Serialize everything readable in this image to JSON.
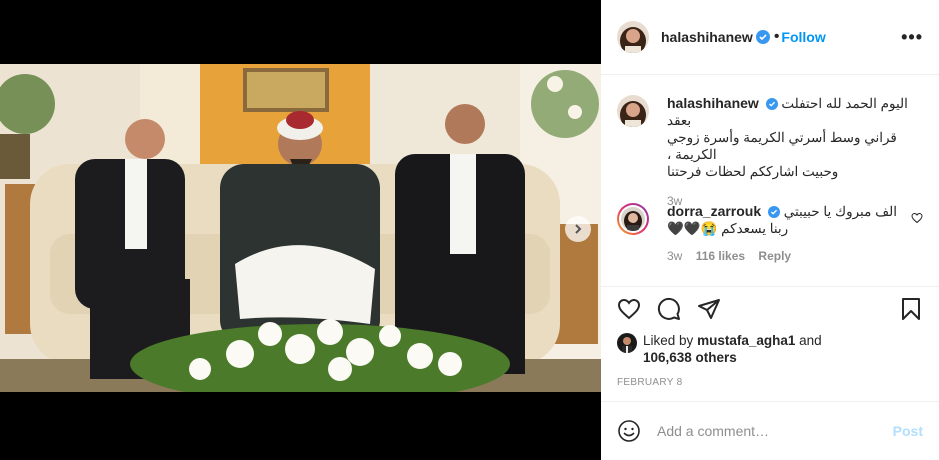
{
  "post": {
    "username": "halashihanew",
    "follow_label": "Follow",
    "more_label": "•••",
    "caption_line1": "اليوم الحمد لله احتفلت بعقد",
    "caption_line2": "قراني وسط أسرتي الكريمة وأسرة زوجي الكريمة ،",
    "caption_line3": "وحبيت اشارككم لحظات فرحتنا",
    "caption_time": "3w"
  },
  "comment": {
    "username": "dorra_zarrouk",
    "line1": "الف مبروك يا حبيبتي",
    "line2": "ربنا يسعدكم 😭🖤🖤",
    "time": "3w",
    "likes": "116 likes",
    "reply_label": "Reply"
  },
  "likes": {
    "prefix": "Liked by",
    "user": "mustafa_agha1",
    "and": "and",
    "others": "106,638 others"
  },
  "date": "FEBRUARY 8",
  "add_comment": {
    "placeholder": "Add a comment…",
    "post_label": "Post"
  },
  "colors": {
    "link_blue": "#0095f6",
    "post_disabled": "#b2dffc",
    "muted": "#8e8e8e",
    "text": "#262626"
  },
  "icons": [
    "verified-badge-icon",
    "more-options-icon",
    "heart-icon",
    "comment-icon",
    "share-icon",
    "bookmark-icon",
    "emoji-icon",
    "chevron-right-icon"
  ]
}
